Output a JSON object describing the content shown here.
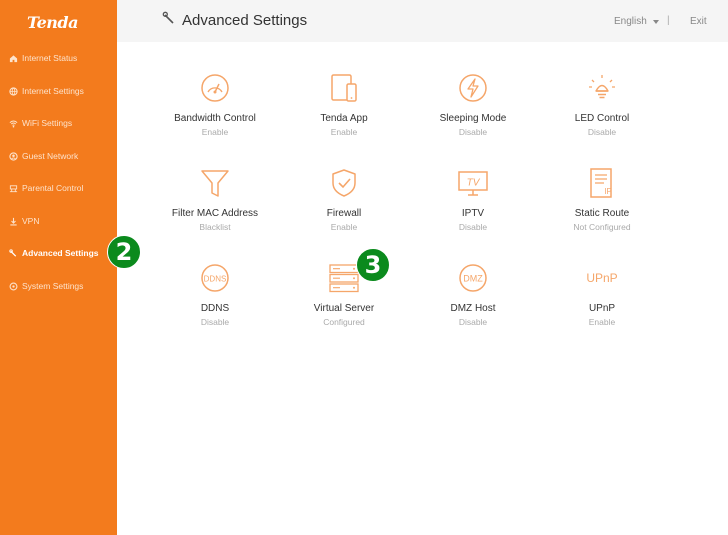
{
  "brand": {
    "logo_text": "Tenda",
    "accent_color": "#f37b1d",
    "badge_color": "#0b8a1d"
  },
  "sidebar": {
    "items": [
      {
        "label": "Internet Status",
        "icon": "home-icon",
        "active": false
      },
      {
        "label": "Internet Settings",
        "icon": "globe-icon",
        "active": false
      },
      {
        "label": "WiFi Settings",
        "icon": "wifi-icon",
        "active": false
      },
      {
        "label": "Guest Network",
        "icon": "guest-icon",
        "active": false
      },
      {
        "label": "Parental Control",
        "icon": "parental-icon",
        "active": false
      },
      {
        "label": "VPN",
        "icon": "vpn-icon",
        "active": false
      },
      {
        "label": "Advanced Settings",
        "icon": "wrench-icon",
        "active": true
      },
      {
        "label": "System Settings",
        "icon": "gear-icon",
        "active": false
      }
    ]
  },
  "header": {
    "title": "Advanced Settings",
    "language": "English",
    "separator": "|",
    "exit_label": "Exit"
  },
  "tiles": [
    {
      "name": "Bandwidth Control",
      "status": "Enable",
      "icon": "speedometer-icon"
    },
    {
      "name": "Tenda App",
      "status": "Enable",
      "icon": "devices-icon"
    },
    {
      "name": "Sleeping Mode",
      "status": "Disable",
      "icon": "lightning-icon"
    },
    {
      "name": "LED Control",
      "status": "Disable",
      "icon": "bulb-icon"
    },
    {
      "name": "Filter MAC Address",
      "status": "Blacklist",
      "icon": "funnel-icon"
    },
    {
      "name": "Firewall",
      "status": "Enable",
      "icon": "shield-icon"
    },
    {
      "name": "IPTV",
      "status": "Disable",
      "icon": "tv-icon",
      "icon_text": "TV"
    },
    {
      "name": "Static Route",
      "status": "Not Configured",
      "icon": "route-doc-icon",
      "icon_text": "IP"
    },
    {
      "name": "DDNS",
      "status": "Disable",
      "icon": "ddns-icon",
      "icon_text": "DDNS"
    },
    {
      "name": "Virtual Server",
      "status": "Configured",
      "icon": "server-icon"
    },
    {
      "name": "DMZ Host",
      "status": "Disable",
      "icon": "dmz-icon",
      "icon_text": "DMZ"
    },
    {
      "name": "UPnP",
      "status": "Enable",
      "icon": "upnp-icon",
      "icon_text": "UPnP"
    }
  ],
  "badges": [
    {
      "label": "2"
    },
    {
      "label": "3"
    }
  ]
}
